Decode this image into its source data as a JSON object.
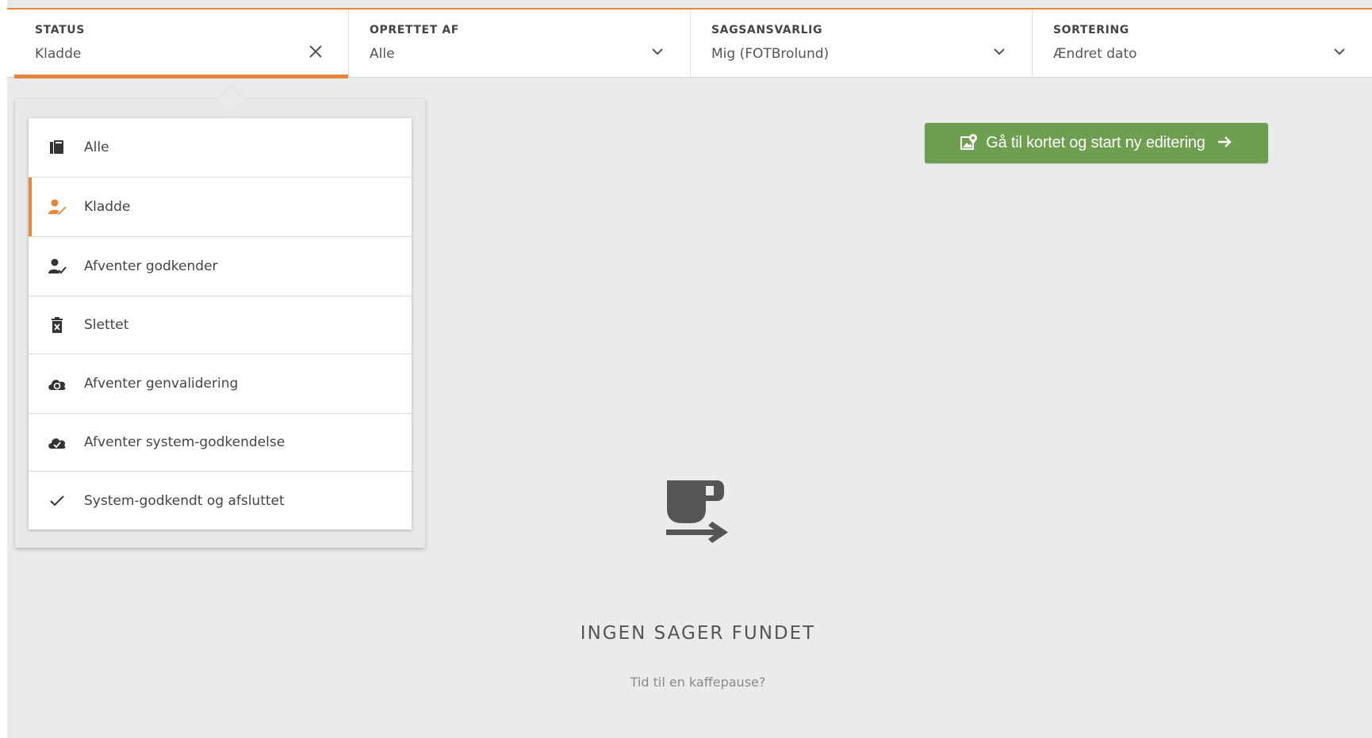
{
  "filters": [
    {
      "label": "STATUS",
      "value": "Kladde",
      "control": "close-icon"
    },
    {
      "label": "OPRETTET AF",
      "value": "Alle",
      "control": "chevron-down-icon"
    },
    {
      "label": "SAGSANSVARLIG",
      "value": "Mig (FOTBrolund)",
      "control": "chevron-down-icon"
    },
    {
      "label": "SORTERING",
      "value": "Ændret dato",
      "control": "chevron-down-icon"
    }
  ],
  "status_dropdown": {
    "selected": "Kladde",
    "items": [
      {
        "label": "Alle",
        "icon": "book-icon"
      },
      {
        "label": "Kladde",
        "icon": "user-edit-icon",
        "icon_color": "#e8843b"
      },
      {
        "label": "Afventer godkender",
        "icon": "user-check-icon"
      },
      {
        "label": "Slettet",
        "icon": "trash-icon"
      },
      {
        "label": "Afventer genvalidering",
        "icon": "cloud-refresh-icon"
      },
      {
        "label": "Afventer system-godkendelse",
        "icon": "cloud-check-icon"
      },
      {
        "label": "System-godkendt og afsluttet",
        "icon": "check-icon"
      }
    ]
  },
  "action_button": {
    "label": "Gå til kortet og start ny editering",
    "icon": "map-marker-icon",
    "trailing_icon": "arrow-right-icon",
    "color": "#6e9e4f"
  },
  "empty_state": {
    "icon": "coffee-cup-arrow-icon",
    "title": "INGEN SAGER FUNDET",
    "subtitle": "Tid til en kaffepause?"
  },
  "colors": {
    "accent": "#e8843b",
    "background": "#ebebeb",
    "button_green": "#6e9e4f"
  }
}
